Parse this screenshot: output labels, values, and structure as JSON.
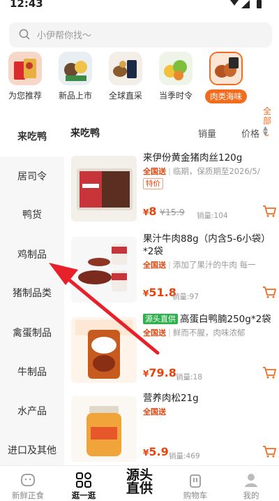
{
  "status": {
    "time": "12:43"
  },
  "search": {
    "placeholder": "小伊帮你找～"
  },
  "categories": [
    {
      "label": "为您推荐"
    },
    {
      "label": "新品上市"
    },
    {
      "label": "全球直采"
    },
    {
      "label": "当季时令"
    },
    {
      "label": "肉类海味"
    }
  ],
  "all_categories": [
    "全",
    "部"
  ],
  "sidebar": [
    "来吃鸭",
    "居司令",
    "鸭货",
    "鸡制品",
    "猪制品类",
    "禽蛋制品",
    "牛制品",
    "水产品",
    "进口及其他"
  ],
  "list_header": {
    "title": "来吃鸭",
    "sort_sales": "销量",
    "sort_price": "价格"
  },
  "products": [
    {
      "name": "来伊份黄金猪肉丝120g",
      "ship": "全国送",
      "desc": "临期，保质期至2026/5/",
      "promo": "特价",
      "price_cur": "¥",
      "price": "8",
      "orig_price": "¥15.9",
      "sold": "销量:104"
    },
    {
      "name": "果汁牛肉88g（内含5-6小袋）*2袋",
      "ship": "全国送",
      "desc": "添加了果汁的牛肉 每一",
      "price_cur": "¥",
      "price": "51.8",
      "sold": "销量:97"
    },
    {
      "name_badge": "源头直供",
      "name": "高蛋白鸭腩250g*2袋",
      "ship": "全国送",
      "desc": "鲜而不腥，肉味浓郁",
      "price_cur": "¥",
      "price": "79.8",
      "sold": "销量:18"
    },
    {
      "name": "营养肉松21g",
      "ship": "全国送",
      "price_cur": "¥",
      "price": "5.9",
      "sold": "销量:469"
    }
  ],
  "tabs": [
    {
      "label": "新鲜正食"
    },
    {
      "label": "逛一逛"
    },
    {
      "label_big_1": "源头",
      "label_big_2": "直供"
    },
    {
      "label": "购物车"
    },
    {
      "label": "我的"
    }
  ],
  "colors": {
    "accent": "#f36c1d",
    "price": "#e8450c",
    "annotation_arrow": "#e8202a"
  }
}
